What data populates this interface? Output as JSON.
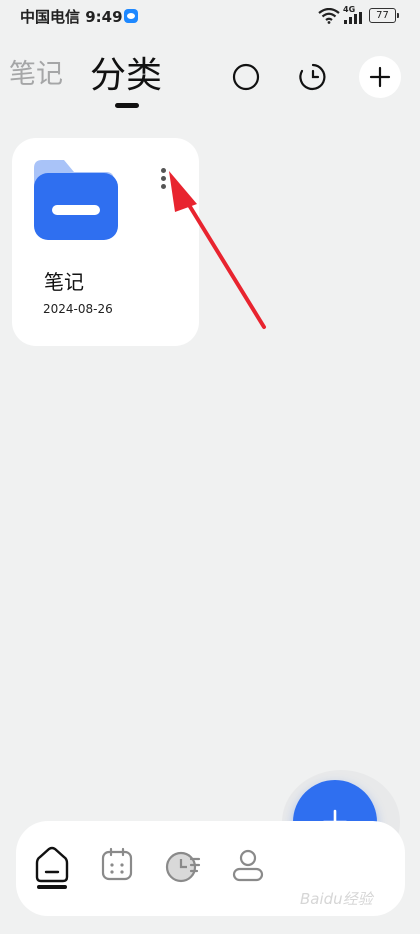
{
  "status_bar": {
    "carrier_time": "中国电信 9:49",
    "signal_label": "4G",
    "battery": "77"
  },
  "header": {
    "tabs": [
      {
        "label": "笔记",
        "active": false
      },
      {
        "label": "分类",
        "active": true
      }
    ],
    "actions": [
      "circle-icon",
      "clock-icon",
      "plus-icon"
    ]
  },
  "categories": [
    {
      "title": "笔记",
      "date": "2024-08-26",
      "icon": "folder-icon",
      "color": "#2f6ff0"
    }
  ],
  "annotation": {
    "type": "arrow",
    "color": "#e8242f"
  },
  "bottom_nav": {
    "items": [
      "home-icon",
      "calendar-icon",
      "timeline-icon",
      "profile-icon"
    ],
    "active": 0
  },
  "fab": {
    "icon": "plus-icon",
    "color": "#2f6ff0"
  },
  "watermark": "Baidu经验"
}
